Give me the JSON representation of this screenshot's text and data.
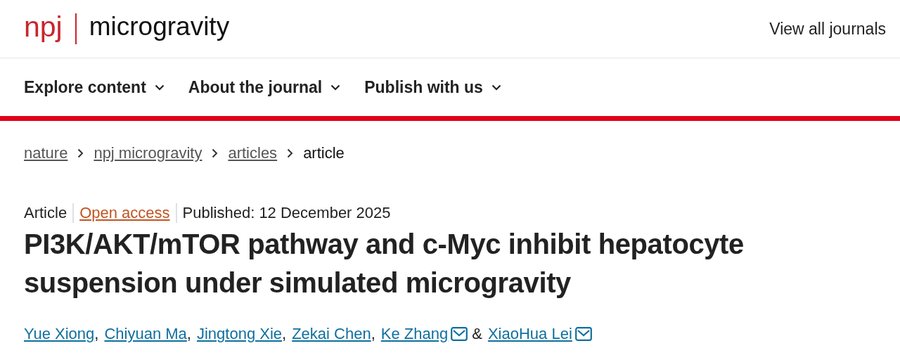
{
  "header": {
    "brand": "npj",
    "journal": "microgravity",
    "link": "View all journals"
  },
  "nav": [
    {
      "label": "Explore content",
      "expanded": false
    },
    {
      "label": "About the journal",
      "expanded": false
    },
    {
      "label": "Publish with us",
      "expanded": false
    }
  ],
  "breadcrumbs": [
    {
      "label": "nature",
      "current": false
    },
    {
      "label": "npj microgravity",
      "current": false
    },
    {
      "label": "articles",
      "current": false
    },
    {
      "label": "article",
      "current": true
    }
  ],
  "article": {
    "type": "Article",
    "access": "Open access",
    "published": "Published: 12 December 2025",
    "title": "PI3K/AKT/mTOR pathway and c-Myc inhibit hepatocyte suspension under simulated microgravity",
    "authors": [
      {
        "name": "Yue Xiong",
        "email": false,
        "after": ","
      },
      {
        "name": "Chiyuan Ma",
        "email": false,
        "after": ","
      },
      {
        "name": "Jingtong Xie",
        "email": false,
        "after": ","
      },
      {
        "name": "Zekai Chen",
        "email": false,
        "after": ","
      },
      {
        "name": "Ke Zhang",
        "email": true,
        "after": "&"
      },
      {
        "name": "XiaoHua Lei",
        "email": true
      }
    ]
  }
}
